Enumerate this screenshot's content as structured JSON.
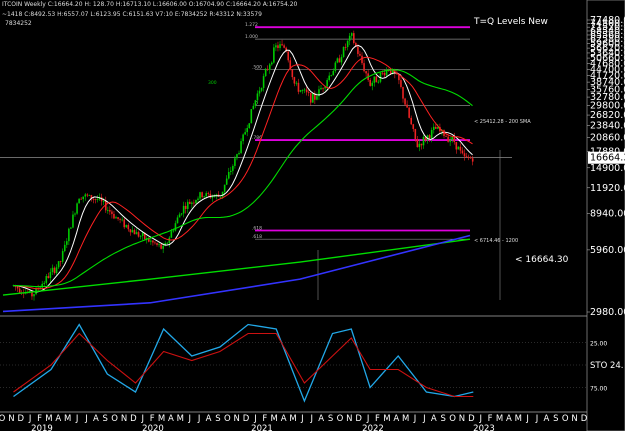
{
  "header": {
    "line1": "ITCOIN Weekly  C:16664.20  H:  128.70  H:16713.10  L:16606.00  O:16704.90  C:16664.20  A:16754.20",
    "line2": "~1418  C:8492.53  H:6557.07  L:6123.95  C:6151.63  V7:10  E:7834252  R:43312  N:33579",
    "line3": "7834252"
  },
  "indicator_title": "T=Q Levels New",
  "current_price_label": "< 16664.30",
  "colors": {
    "background": "#000000",
    "candle_up": "#00cc00",
    "candle_down": "#ee2222",
    "fib_level": "#dd00dd",
    "sma_200": "#00dd00",
    "ma_red": "#ff2222",
    "ma_white": "#ffffff",
    "ma_blue": "#3333ff",
    "stoch_fast": "#22a8e8",
    "stoch_slow": "#cc1111",
    "price_box": "#ffffff"
  },
  "chart_data": [
    {
      "type": "candlestick",
      "title": "BITCOIN Weekly",
      "scale": "log",
      "y_ticks": [
        "77480.00",
        "74500.00",
        "71520.00",
        "68540.00",
        "65560.00",
        "62580.00",
        "59600.00",
        "56620.00",
        "53640.00",
        "50660.00",
        "47680.00",
        "44700.00",
        "41720.00",
        "38740.00",
        "35760.00",
        "32780.00",
        "29800.00",
        "26820.00",
        "23840.00",
        "20860.00",
        "17880.00",
        "14900.00",
        "11920.00",
        "8940.00",
        "5960.00",
        "2980.00"
      ],
      "x_ticks": [
        "O",
        "N",
        "D",
        "J",
        "F",
        "M",
        "A",
        "M",
        "J",
        "J",
        "A",
        "S",
        "O",
        "N",
        "D",
        "J",
        "F",
        "M",
        "A",
        "M",
        "J",
        "J",
        "A",
        "S",
        "O",
        "N",
        "D",
        "J",
        "F",
        "M",
        "A",
        "M",
        "J",
        "J",
        "A",
        "S",
        "O",
        "N",
        "D",
        "J",
        "F",
        "M",
        "A",
        "M",
        "J",
        "J",
        "A",
        "S",
        "O",
        "N",
        "D",
        "J",
        "F",
        "M",
        "A",
        "M",
        "J",
        "J",
        "A",
        "S",
        "O",
        "N",
        "D"
      ],
      "years": [
        "2019",
        "2020",
        "2021",
        "2022",
        "2023"
      ],
      "ylim": [
        2980,
        77480
      ],
      "price_box": "16664.30",
      "annotations": [
        "< 25412.28 - 200 SMA",
        "< 6714.46 - 1200"
      ],
      "fib_labels": [
        "1.272",
        "1.000",
        ".500",
        "0",
        ".786",
        ".618",
        ".618"
      ],
      "series": [
        {
          "name": "weekly close",
          "x": [
            "2018-11",
            "2019-01",
            "2019-04",
            "2019-06",
            "2019-08",
            "2019-10",
            "2019-12",
            "2020-03",
            "2020-05",
            "2020-07",
            "2020-09",
            "2020-11",
            "2021-01",
            "2021-03",
            "2021-04",
            "2021-05",
            "2021-07",
            "2021-09",
            "2021-11",
            "2022-01",
            "2022-03",
            "2022-04",
            "2022-06",
            "2022-08",
            "2022-10",
            "2022-11",
            "2022-12"
          ],
          "values": [
            4000,
            3600,
            5200,
            11000,
            10500,
            8500,
            7200,
            6000,
            9500,
            11000,
            10800,
            18000,
            34000,
            58000,
            57000,
            37000,
            32000,
            44000,
            65000,
            38000,
            45000,
            40000,
            19000,
            23000,
            20000,
            16500,
            16664
          ]
        }
      ]
    },
    {
      "type": "line",
      "title": "STO",
      "y_ticks": [
        "25.00",
        "75.00"
      ],
      "side_label": "STO  24.",
      "series": [
        {
          "name": "%K",
          "x": [
            "2018-11",
            "2019-03",
            "2019-06",
            "2019-09",
            "2019-12",
            "2020-03",
            "2020-06",
            "2020-09",
            "2020-12",
            "2021-03",
            "2021-06",
            "2021-09",
            "2021-11",
            "2022-01",
            "2022-04",
            "2022-07",
            "2022-10",
            "2022-12"
          ],
          "values": [
            85,
            55,
            5,
            60,
            80,
            10,
            40,
            30,
            5,
            10,
            90,
            15,
            10,
            75,
            40,
            80,
            85,
            80
          ]
        },
        {
          "name": "%D",
          "x": [
            "2018-11",
            "2019-03",
            "2019-06",
            "2019-09",
            "2019-12",
            "2020-03",
            "2020-06",
            "2020-09",
            "2020-12",
            "2021-03",
            "2021-06",
            "2021-09",
            "2021-11",
            "2022-01",
            "2022-04",
            "2022-07",
            "2022-10",
            "2022-12"
          ],
          "values": [
            80,
            50,
            15,
            45,
            70,
            35,
            45,
            35,
            15,
            15,
            70,
            40,
            20,
            55,
            55,
            75,
            85,
            85
          ]
        }
      ]
    }
  ]
}
